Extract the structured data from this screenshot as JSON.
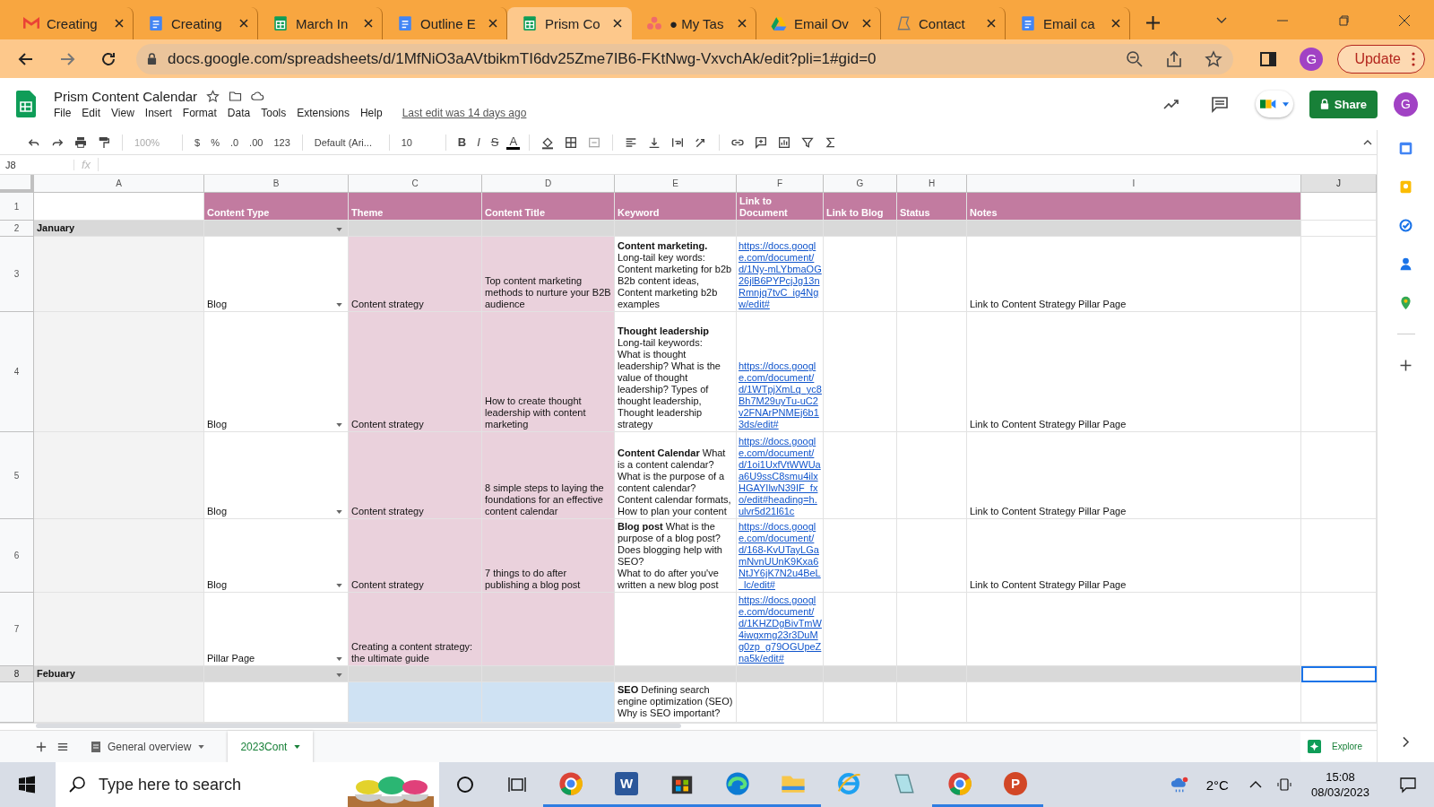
{
  "browser": {
    "tabs": [
      {
        "title": "Creating",
        "kind": "gmail",
        "selected": false
      },
      {
        "title": "Creating",
        "kind": "docs",
        "selected": false
      },
      {
        "title": "March In",
        "kind": "sheets",
        "selected": false
      },
      {
        "title": "Outline E",
        "kind": "docs",
        "selected": false
      },
      {
        "title": "Prism Co",
        "kind": "sheets",
        "selected": true
      },
      {
        "title": "● My Tas",
        "kind": "asana",
        "selected": false
      },
      {
        "title": "Email Ov",
        "kind": "drive",
        "selected": false
      },
      {
        "title": "Contact",
        "kind": "outline",
        "selected": false
      },
      {
        "title": "Email ca",
        "kind": "docs",
        "selected": false
      }
    ],
    "url": "docs.google.com/spreadsheets/d/1MfNiO3aAVtbikmTI6dv25Zme7IB6-FKtNwg-VxvchAk/edit?pli=1#gid=0",
    "profile": "G",
    "update": "Update"
  },
  "document": {
    "title": "Prism Content Calendar",
    "menus": [
      "File",
      "Edit",
      "View",
      "Insert",
      "Format",
      "Data",
      "Tools",
      "Extensions",
      "Help"
    ],
    "last_edit": "Last edit was 14 days ago",
    "share": "Share",
    "avatar": "G"
  },
  "toolbar": {
    "zoom": "100%",
    "currency": "$",
    "percent": "%",
    "decrease_decimal": ".0",
    "increase_decimal": ".00",
    "number_format": "123",
    "font": "Default (Ari...",
    "font_size": "10",
    "bold": "B",
    "italic": "I",
    "strikethrough": "S",
    "text_color": "A"
  },
  "formula_bar": {
    "name_box": "J8",
    "fx": "fx"
  },
  "columns": [
    {
      "letter": "A",
      "selected": false
    },
    {
      "letter": "B",
      "selected": false
    },
    {
      "letter": "C",
      "selected": false
    },
    {
      "letter": "D",
      "selected": false
    },
    {
      "letter": "E",
      "selected": false
    },
    {
      "letter": "F",
      "selected": false
    },
    {
      "letter": "G",
      "selected": false
    },
    {
      "letter": "H",
      "selected": false
    },
    {
      "letter": "I",
      "selected": false
    },
    {
      "letter": "J",
      "selected": true
    }
  ],
  "rows": [
    {
      "number": "1",
      "kind": "header",
      "selected": false,
      "cells": {
        "B": "Content Type",
        "C": "Theme",
        "D": "Content Title",
        "E": "Keyword",
        "F": "Link to Document",
        "G": "Link to Blog",
        "H": "Status",
        "I": "Notes"
      }
    },
    {
      "number": "2",
      "kind": "month",
      "selected": false,
      "dropdown": true,
      "cells": {
        "A": "January"
      }
    },
    {
      "number": "3",
      "kind": "entry",
      "selected": false,
      "dropdown": true,
      "color": "#ead1dc",
      "cells": {
        "B": "Blog",
        "C": "Content strategy",
        "D": "Top content marketing methods to nurture your B2B audience",
        "E": "**Content marketing.**\nLong-tail key words:\nContent marketing for b2b\nB2b content ideas,\nContent marketing b2b examples",
        "F": "https://docs.google.com/document/d/1Ny-mLYbmaOG26jlB6PYPcjJg13nRmnjq7tvC_ig4Ngw/edit#",
        "I": "Link to Content Strategy Pillar Page"
      }
    },
    {
      "number": "4",
      "kind": "entry",
      "selected": false,
      "dropdown": true,
      "color": "#ead1dc",
      "cells": {
        "B": "Blog",
        "C": "Content strategy",
        "D": "How to create thought leadership with content marketing",
        "E": "**Thought leadership**\nLong-tail keywords:\nWhat is thought leadership? What is the value of thought leadership? Types of thought leadership,\nThought leadership strategy",
        "F": "https://docs.google.com/document/d/1WTpjXmLq_yc8Bh7M29uyTu-uC2v2FNArPNMEj6b13ds/edit#",
        "I": "Link to Content Strategy Pillar Page"
      }
    },
    {
      "number": "5",
      "kind": "entry",
      "selected": false,
      "dropdown": true,
      "color": "#ead1dc",
      "cells": {
        "B": "Blog",
        "C": "Content strategy",
        "D": "8 simple steps to laying the foundations for an effective content calendar",
        "E": "**Content Calendar** What is a content calendar?\nWhat is the purpose of a content calendar?\nContent calendar formats,\nHow to plan your content",
        "F": "https://docs.google.com/document/d/1oi1UxfVtWWUaa6U9ssC8smu4ilxHGAYIlwN39IF_fxo/edit#heading=h.ulvr5d21l61c",
        "I": "Link to Content Strategy Pillar Page"
      }
    },
    {
      "number": "6",
      "kind": "entry",
      "selected": false,
      "dropdown": true,
      "color": "#ead1dc",
      "cells": {
        "B": "Blog",
        "C": "Content strategy",
        "D": "7 things to do after publishing a blog post",
        "E": "**Blog post** What is the purpose of a blog post? Does blogging help with SEO?\nWhat to do after you've written a new blog post",
        "F": "https://docs.google.com/document/d/168-KvUTayLGamNvnUUnK9Kxa6NtJY6jK7N2u4BeL_lc/edit#",
        "I": "Link to Content Strategy Pillar Page"
      }
    },
    {
      "number": "7",
      "kind": "entry",
      "selected": false,
      "dropdown": true,
      "color": "#ead1dc",
      "cells": {
        "B": "Pillar Page",
        "C": "Creating a content strategy: the ultimate guide",
        "F": "https://docs.google.com/document/d/1KHZDgBivTmW4iwgxmg23r3DuMg0zp_g79OGUpeZna5k/edit#"
      }
    },
    {
      "number": "8",
      "kind": "month",
      "selected": true,
      "dropdown": true,
      "cells": {
        "A": "Febuary"
      }
    },
    {
      "number": "",
      "kind": "entry",
      "selected": false,
      "color": "#cfe2f3",
      "cells": {
        "E": "**SEO** Defining search engine optimization (SEO)\nWhy is SEO important?"
      }
    }
  ],
  "sheets": [
    {
      "name": "General overview",
      "selected": false
    },
    {
      "name": "2023Cont",
      "selected": true
    }
  ],
  "explore": "Explore",
  "taskbar": {
    "search_placeholder": "Type here to search",
    "apps": [
      {
        "kind": "chrome",
        "running": true
      },
      {
        "kind": "word",
        "letter": "W",
        "running": true
      },
      {
        "kind": "store",
        "running": true
      },
      {
        "kind": "edge",
        "running": true
      },
      {
        "kind": "folder",
        "running": true
      },
      {
        "kind": "ie",
        "running": false
      },
      {
        "kind": "notepad",
        "running": false
      },
      {
        "kind": "chrome",
        "running": true
      },
      {
        "kind": "powerpoint",
        "letter": "P",
        "running": true
      }
    ],
    "temperature": "2°C",
    "time": "15:08",
    "date": "08/03/2023"
  }
}
